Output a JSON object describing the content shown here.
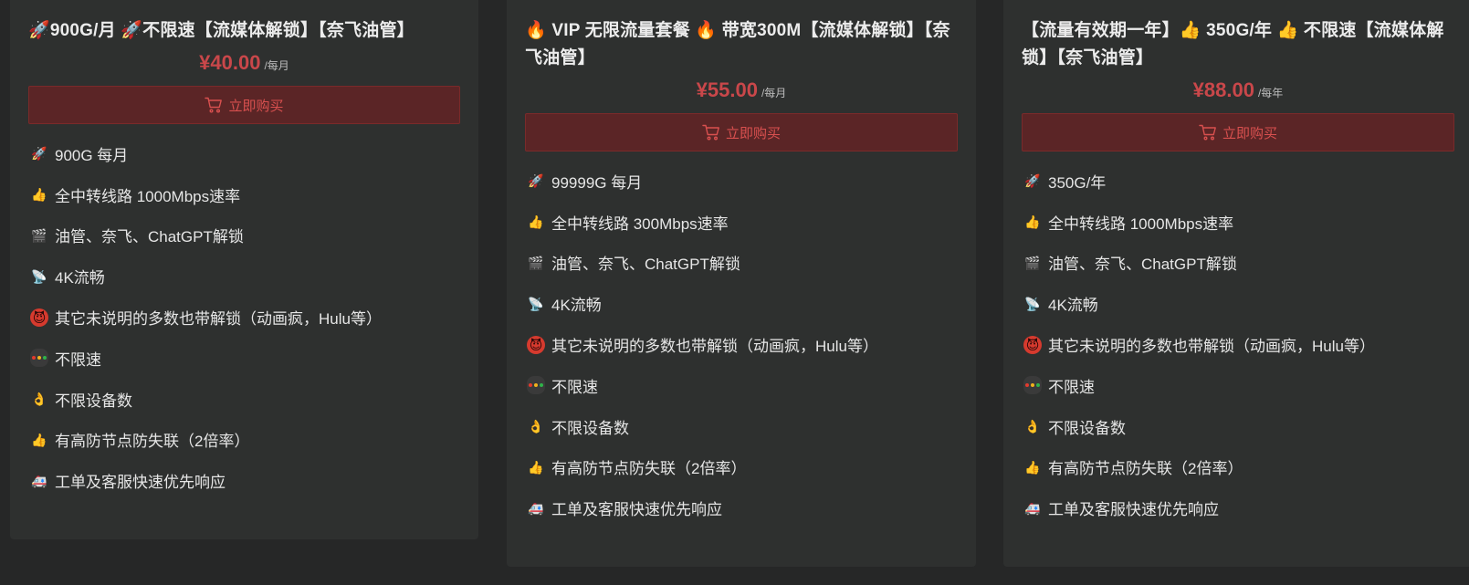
{
  "plans": [
    {
      "title_parts": [
        {
          "type": "icon",
          "name": "rocket-icon"
        },
        {
          "type": "text",
          "value": "900G/月 "
        },
        {
          "type": "icon",
          "name": "rocket-icon"
        },
        {
          "type": "text",
          "value": "不限速【流媒体解锁】【奈飞油管】"
        }
      ],
      "price": "¥40.00",
      "unit": "/每月",
      "buy_label": "立即购买",
      "features": [
        {
          "icon": "rocket-icon",
          "text": "900G 每月"
        },
        {
          "icon": "thumbs-up-icon",
          "text": "全中转线路 1000Mbps速率"
        },
        {
          "icon": "clapperboard-icon",
          "text": "油管、奈飞、ChatGPT解锁"
        },
        {
          "icon": "satellite-dish-icon",
          "text": "4K流畅"
        },
        {
          "icon": "devil-face-icon",
          "text": "其它未说明的多数也带解锁（动画疯，Hulu等）"
        },
        {
          "icon": "traffic-light-icon",
          "text": "不限速"
        },
        {
          "icon": "ok-hand-icon",
          "text": "不限设备数"
        },
        {
          "icon": "thumbs-up-icon",
          "text": "有高防节点防失联（2倍率）"
        },
        {
          "icon": "ambulance-icon",
          "text": "工单及客服快速优先响应"
        }
      ]
    },
    {
      "title_parts": [
        {
          "type": "icon",
          "name": "fire-icon"
        },
        {
          "type": "text",
          "value": " VIP 无限流量套餐 "
        },
        {
          "type": "icon",
          "name": "fire-icon"
        },
        {
          "type": "text",
          "value": " 带宽300M【流媒体解锁】【奈飞油管】"
        }
      ],
      "price": "¥55.00",
      "unit": "/每月",
      "buy_label": "立即购买",
      "features": [
        {
          "icon": "rocket-icon",
          "text": "99999G 每月"
        },
        {
          "icon": "thumbs-up-icon",
          "text": "全中转线路 300Mbps速率"
        },
        {
          "icon": "clapperboard-icon",
          "text": "油管、奈飞、ChatGPT解锁"
        },
        {
          "icon": "satellite-dish-icon",
          "text": "4K流畅"
        },
        {
          "icon": "devil-face-icon",
          "text": "其它未说明的多数也带解锁（动画疯，Hulu等）"
        },
        {
          "icon": "traffic-light-icon",
          "text": "不限速"
        },
        {
          "icon": "ok-hand-icon",
          "text": "不限设备数"
        },
        {
          "icon": "thumbs-up-icon",
          "text": "有高防节点防失联（2倍率）"
        },
        {
          "icon": "ambulance-icon",
          "text": "工单及客服快速优先响应"
        }
      ]
    },
    {
      "title_parts": [
        {
          "type": "text",
          "value": "【流量有效期一年】"
        },
        {
          "type": "icon",
          "name": "thumbs-up-icon"
        },
        {
          "type": "text",
          "value": " 350G/年 "
        },
        {
          "type": "icon",
          "name": "thumbs-up-icon"
        },
        {
          "type": "text",
          "value": " 不限速【流媒体解锁】【奈飞油管】"
        }
      ],
      "price": "¥88.00",
      "unit": "/每年",
      "buy_label": "立即购买",
      "features": [
        {
          "icon": "rocket-icon",
          "text": "350G/年"
        },
        {
          "icon": "thumbs-up-icon",
          "text": "全中转线路 1000Mbps速率"
        },
        {
          "icon": "clapperboard-icon",
          "text": "油管、奈飞、ChatGPT解锁"
        },
        {
          "icon": "satellite-dish-icon",
          "text": "4K流畅"
        },
        {
          "icon": "devil-face-icon",
          "text": "其它未说明的多数也带解锁（动画疯，Hulu等）"
        },
        {
          "icon": "traffic-light-icon",
          "text": "不限速"
        },
        {
          "icon": "ok-hand-icon",
          "text": "不限设备数"
        },
        {
          "icon": "thumbs-up-icon",
          "text": "有高防节点防失联（2倍率）"
        },
        {
          "icon": "ambulance-icon",
          "text": "工单及客服快速优先响应"
        }
      ]
    }
  ],
  "colors": {
    "page_bg": "#262727",
    "card_bg": "#2e302f",
    "price": "#c9474a",
    "button_bg": "#5b2526",
    "button_text": "#d9504f"
  }
}
